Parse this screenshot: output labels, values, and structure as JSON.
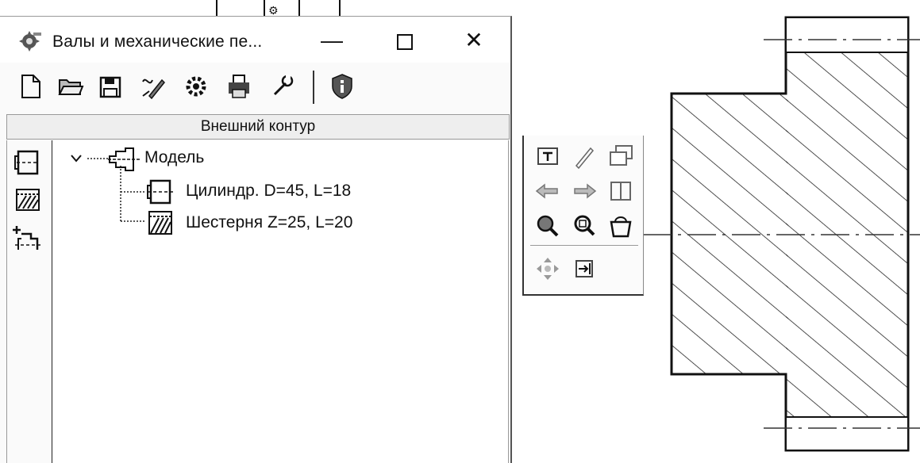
{
  "window": {
    "title": "Валы и механические пе...",
    "minimize_glyph": "—",
    "close_glyph": "✕"
  },
  "toolbar": {
    "buttons": [
      {
        "icon": "new-document-icon"
      },
      {
        "icon": "open-folder-icon"
      },
      {
        "icon": "save-icon"
      },
      {
        "icon": "edit-pen-icon"
      },
      {
        "icon": "gear-settings-icon"
      },
      {
        "icon": "print-icon"
      },
      {
        "icon": "wrench-icon"
      },
      {
        "icon": "shield-info-icon"
      }
    ]
  },
  "section": {
    "header": "Внешний контур"
  },
  "left_strip": {
    "buttons": [
      {
        "icon": "cylinder-icon"
      },
      {
        "icon": "gear-hatched-icon"
      },
      {
        "icon": "add-element-icon"
      }
    ]
  },
  "tree": {
    "root_label": "Модель",
    "items": [
      {
        "label": "Цилиндр. D=45, L=18",
        "icon": "cylinder-icon"
      },
      {
        "label": "Шестерня Z=25, L=20",
        "icon": "gear-hatched-icon"
      }
    ]
  },
  "palette": {
    "buttons": [
      "insert-icon",
      "pencil-icon",
      "copy-windows-icon",
      "arrow-left-icon",
      "arrow-right-icon",
      "panel-split-icon",
      "zoom-search-icon",
      "zoom-page-icon",
      "basket-icon",
      "move-icon",
      "exit-icon"
    ]
  },
  "colors": {
    "line": "#111111",
    "hatch": "#222222",
    "background": "#ffffff"
  }
}
